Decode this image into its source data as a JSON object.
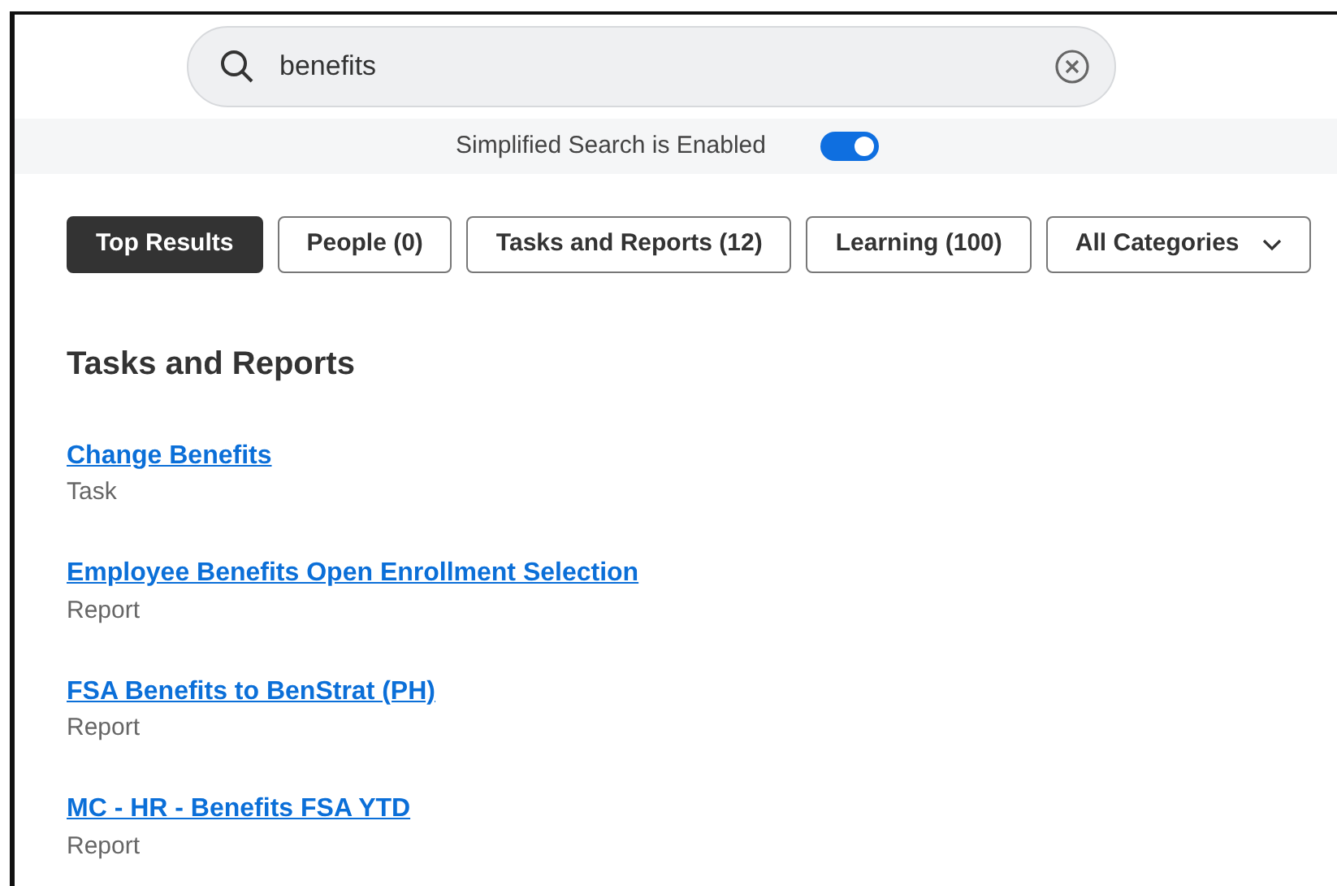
{
  "search": {
    "value": "benefits"
  },
  "simplified_search": {
    "label": "Simplified Search is Enabled",
    "on": true
  },
  "filters": [
    {
      "label": "Top Results",
      "selected": true,
      "kind": "chip"
    },
    {
      "label": "People (0)",
      "selected": false,
      "kind": "chip"
    },
    {
      "label": "Tasks and Reports (12)",
      "selected": false,
      "kind": "chip"
    },
    {
      "label": "Learning (100)",
      "selected": false,
      "kind": "chip"
    },
    {
      "label": "All Categories",
      "selected": false,
      "kind": "dropdown"
    }
  ],
  "section": {
    "title": "Tasks and Reports",
    "results": [
      {
        "title": "Change Benefits",
        "type": "Task"
      },
      {
        "title": "Employee Benefits Open Enrollment Selection",
        "type": "Report"
      },
      {
        "title": "FSA Benefits to BenStrat (PH)",
        "type": "Report"
      },
      {
        "title": "MC - HR - Benefits FSA YTD",
        "type": "Report"
      }
    ]
  }
}
